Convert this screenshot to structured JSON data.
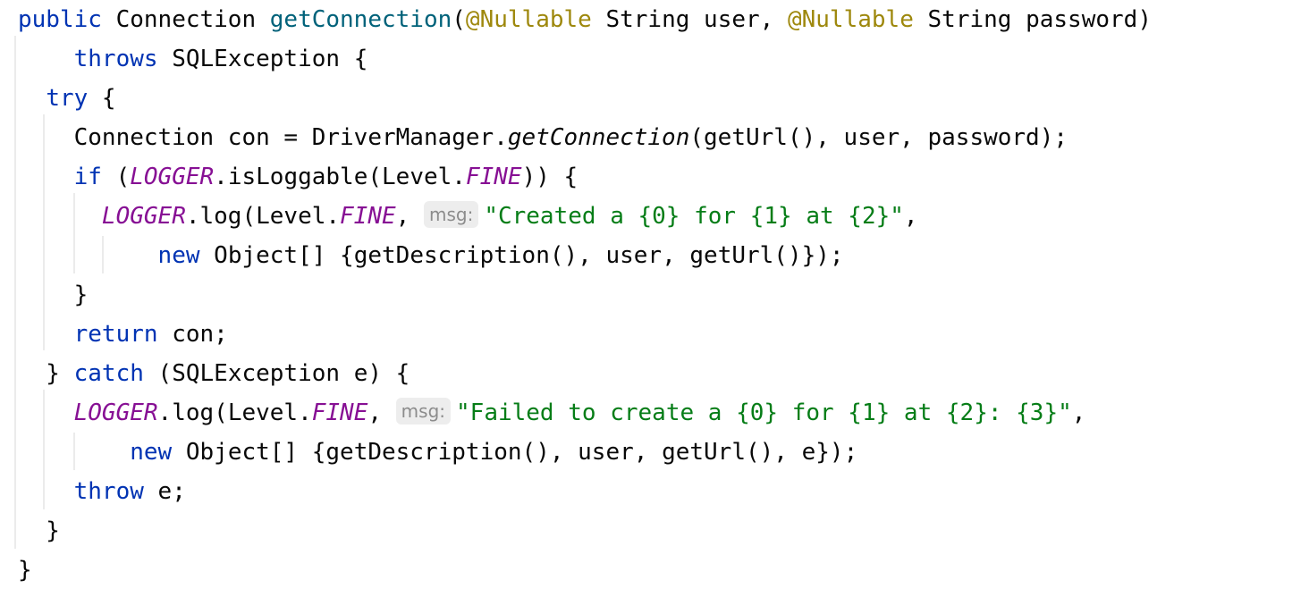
{
  "editor": {
    "lines": [
      [
        {
          "t": "public",
          "c": "kw"
        },
        {
          "t": " Connection "
        },
        {
          "t": "getConnection",
          "c": "fn"
        },
        {
          "t": "("
        },
        {
          "t": "@Nullable",
          "c": "ann"
        },
        {
          "t": " String user, "
        },
        {
          "t": "@Nullable",
          "c": "ann"
        },
        {
          "t": " String password)"
        }
      ],
      [
        {
          "t": "    "
        },
        {
          "t": "throws",
          "c": "kw"
        },
        {
          "t": " SQLException {"
        }
      ],
      [
        {
          "t": "  "
        },
        {
          "t": "try",
          "c": "kw"
        },
        {
          "t": " {"
        }
      ],
      [
        {
          "t": "    Connection con = DriverManager."
        },
        {
          "t": "getConnection",
          "c": "ital"
        },
        {
          "t": "(getUrl(), user, password);"
        }
      ],
      [
        {
          "t": "    "
        },
        {
          "t": "if",
          "c": "kw"
        },
        {
          "t": " ("
        },
        {
          "t": "LOGGER",
          "c": "field"
        },
        {
          "t": ".isLoggable(Level."
        },
        {
          "t": "FINE",
          "c": "field"
        },
        {
          "t": ")) {"
        }
      ],
      [
        {
          "t": "      "
        },
        {
          "t": "LOGGER",
          "c": "field"
        },
        {
          "t": ".log(Level."
        },
        {
          "t": "FINE",
          "c": "field"
        },
        {
          "t": ", "
        },
        {
          "t": "msg:",
          "c": "hint"
        },
        {
          "t": "\"Created a {0} for {1} at {2}\"",
          "c": "str"
        },
        {
          "t": ","
        }
      ],
      [
        {
          "t": "          "
        },
        {
          "t": "new",
          "c": "kw"
        },
        {
          "t": " Object[] {getDescription(), user, getUrl()});"
        }
      ],
      [
        {
          "t": "    }"
        }
      ],
      [
        {
          "t": "    "
        },
        {
          "t": "return",
          "c": "kw"
        },
        {
          "t": " con;"
        }
      ],
      [
        {
          "t": "  } "
        },
        {
          "t": "catch",
          "c": "kw"
        },
        {
          "t": " (SQLException e) {"
        }
      ],
      [
        {
          "t": "    "
        },
        {
          "t": "LOGGER",
          "c": "field"
        },
        {
          "t": ".log(Level."
        },
        {
          "t": "FINE",
          "c": "field"
        },
        {
          "t": ", "
        },
        {
          "t": "msg:",
          "c": "hint"
        },
        {
          "t": "\"Failed to create a {0} for {1} at {2}: {3}\"",
          "c": "str"
        },
        {
          "t": ","
        }
      ],
      [
        {
          "t": "        "
        },
        {
          "t": "new",
          "c": "kw"
        },
        {
          "t": " Object[] {getDescription(), user, getUrl(), e});"
        }
      ],
      [
        {
          "t": "    "
        },
        {
          "t": "throw",
          "c": "kw"
        },
        {
          "t": " e;"
        }
      ],
      [
        {
          "t": "  }"
        }
      ],
      [
        {
          "t": "}"
        }
      ]
    ]
  }
}
